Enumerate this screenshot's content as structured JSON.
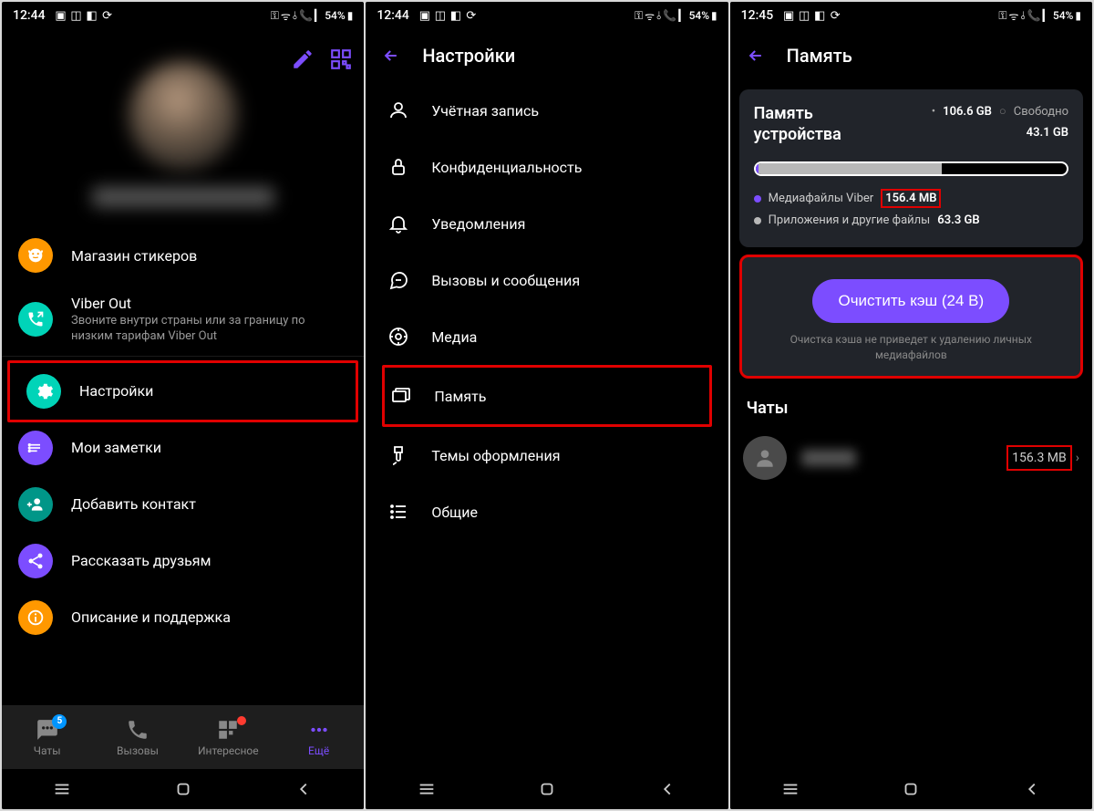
{
  "status": {
    "time1": "12:44",
    "time2": "12:44",
    "time3": "12:45",
    "battery": "54%"
  },
  "screen1": {
    "menu": {
      "stickers": "Магазин стикеров",
      "viberout_title": "Viber Out",
      "viberout_sub": "Звоните внутри страны или за границу по низким тарифам Viber Out",
      "settings": "Настройки",
      "notes": "Мои заметки",
      "addcontact": "Добавить контакт",
      "share": "Рассказать друзьям",
      "help": "Описание и поддержка"
    },
    "tabs": {
      "chats": "Чаты",
      "chats_badge": "5",
      "calls": "Вызовы",
      "explore": "Интересное",
      "more": "Ещё"
    }
  },
  "screen2": {
    "title": "Настройки",
    "items": {
      "account": "Учётная запись",
      "privacy": "Конфиденциальность",
      "notifications": "Уведомления",
      "calls": "Вызовы и сообщения",
      "media": "Медиа",
      "storage": "Память",
      "themes": "Темы оформления",
      "general": "Общие"
    }
  },
  "screen3": {
    "title": "Память",
    "device_title": "Память устройства",
    "total": "106.6 GB",
    "free_label": "Свободно",
    "free": "43.1 GB",
    "viber_label": "Медиафайлы Viber",
    "viber_size": "156.4 MB",
    "apps_label": "Приложения и другие файлы",
    "apps_size": "63.3 GB",
    "clear_btn": "Очистить кэш (24 B)",
    "clear_note": "Очистка кэша не приведет к удалению личных медиафайлов",
    "chats_title": "Чаты",
    "chat_size": "156.3 MB"
  }
}
